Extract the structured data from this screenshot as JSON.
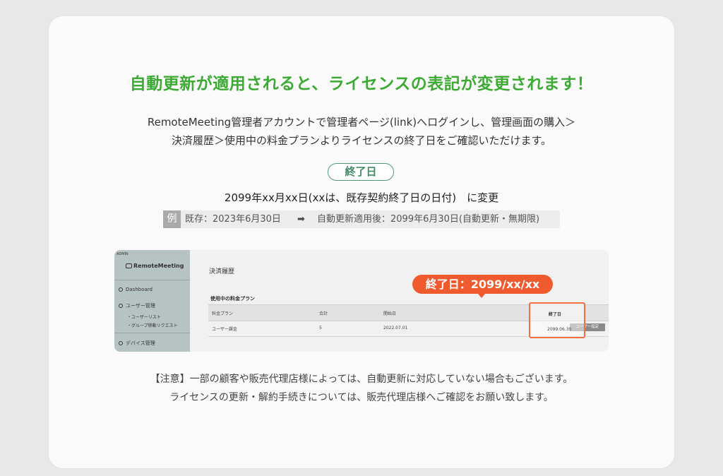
{
  "headline": "自動更新が適用されると、ライセンスの表記が変更されます！",
  "description": {
    "line1": "RemoteMeeting管理者アカウントで管理者ページ(link)へログインし、管理画面の購入＞",
    "line2": "決済履歴＞使用中の料金プランよりライセンスの終了日をご確認いただけます。"
  },
  "end_date_label": "終了日",
  "change_text": "2099年xx月xx日(xxは、既存契約終了日の日付)　に変更",
  "example": {
    "tag": "例",
    "before": "既存：2023年6月30日",
    "arrow": "➡",
    "after": "自動更新適用後：2099年6月30日(自動更新・無期限)"
  },
  "screenshot": {
    "sidebar": {
      "admin": "ADMIN",
      "logo": "RemoteMeeting",
      "items": [
        "Dashboard",
        "ユーザー管理",
        "デバイス管理"
      ],
      "sub_items": [
        "・ユーザーリスト",
        "・グループ移動リクエスト"
      ]
    },
    "main_title": "決済履歴",
    "section_title": "使用中の料金プラン",
    "columns": [
      "料金プラン",
      "合計",
      "開始日",
      "終了日"
    ],
    "row": {
      "plan": "ユーザー課金",
      "total": "5",
      "start": "2022.07.01",
      "end": "2099.06.30",
      "button": "ユーザー指定"
    },
    "callout": "終了日：2099/xx/xx"
  },
  "note": {
    "line1": "【注意】一部の顧客や販売代理店様によっては、自動更新に対応していない場合もございます。",
    "line2": "ライセンスの更新・解約手続きについては、販売代理店様へご確認をお願い致します。"
  },
  "colors": {
    "headline": "#3daa34",
    "pill_border": "#4f9a74",
    "callout": "#ef5a2e",
    "highlight": "#f07040"
  }
}
